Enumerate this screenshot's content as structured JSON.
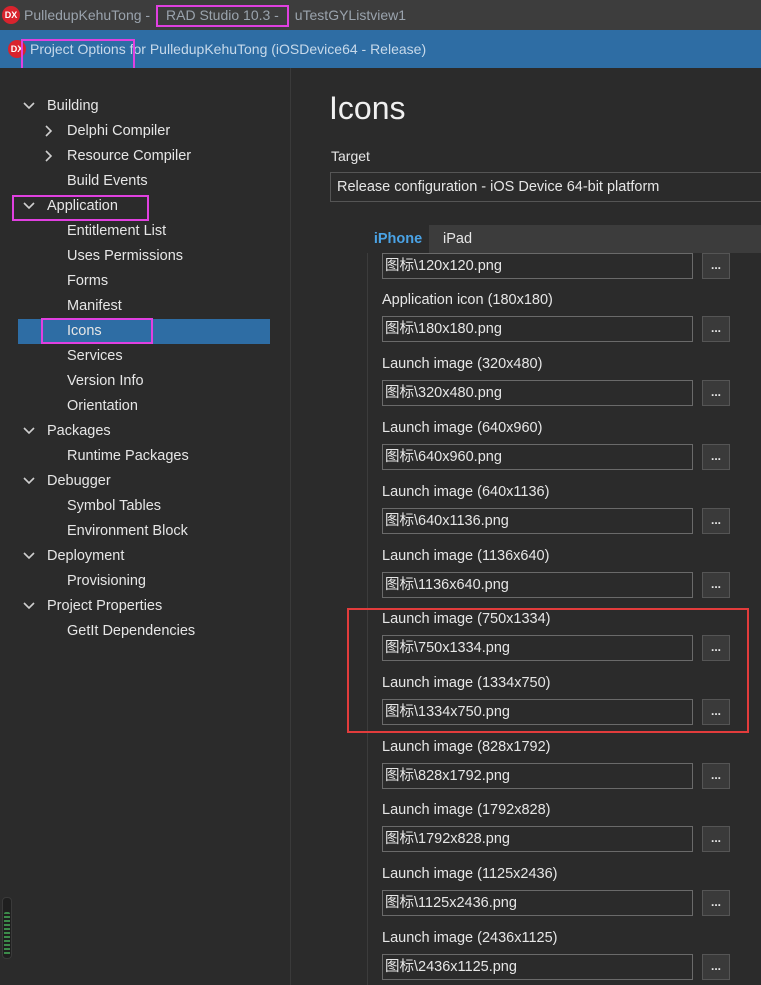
{
  "titlebar": {
    "part1": "PulledupKehuTong - ",
    "part2": "RAD Studio 10.3 -",
    "part3": " uTestGYListview1"
  },
  "dialog": {
    "title_part1": "Project Options",
    "title_part2": " for PulledupKehuTong  (iOSDevice64 - Release)"
  },
  "tree": [
    {
      "label": "Building"
    },
    {
      "label": "Delphi Compiler"
    },
    {
      "label": "Resource Compiler"
    },
    {
      "label": "Build Events"
    },
    {
      "label": "Application"
    },
    {
      "label": "Entitlement List"
    },
    {
      "label": "Uses Permissions"
    },
    {
      "label": "Forms"
    },
    {
      "label": "Manifest"
    },
    {
      "label": "Icons"
    },
    {
      "label": "Services"
    },
    {
      "label": "Version Info"
    },
    {
      "label": "Orientation"
    },
    {
      "label": "Packages"
    },
    {
      "label": "Runtime Packages"
    },
    {
      "label": "Debugger"
    },
    {
      "label": "Symbol Tables"
    },
    {
      "label": "Environment Block"
    },
    {
      "label": "Deployment"
    },
    {
      "label": "Provisioning"
    },
    {
      "label": "Project Properties"
    },
    {
      "label": "GetIt Dependencies"
    }
  ],
  "page": {
    "heading": "Icons",
    "target_label": "Target",
    "target_value": "Release configuration - iOS Device 64-bit platform"
  },
  "tabs": [
    {
      "label": "iPhone"
    },
    {
      "label": "iPad"
    }
  ],
  "fields": [
    {
      "label": "",
      "value": "图标\\120x120.png"
    },
    {
      "label": "Application icon (180x180)",
      "value": "图标\\180x180.png"
    },
    {
      "label": "Launch image (320x480)",
      "value": "图标\\320x480.png"
    },
    {
      "label": "Launch image (640x960)",
      "value": "图标\\640x960.png"
    },
    {
      "label": "Launch image (640x1136)",
      "value": "图标\\640x1136.png"
    },
    {
      "label": "Launch image (1136x640)",
      "value": "图标\\1136x640.png"
    },
    {
      "label": "Launch image (750x1334)",
      "value": "图标\\750x1334.png"
    },
    {
      "label": "Launch image (1334x750)",
      "value": "图标\\1334x750.png"
    },
    {
      "label": "Launch image (828x1792)",
      "value": "图标\\828x1792.png"
    },
    {
      "label": "Launch image (1792x828)",
      "value": "图标\\1792x828.png"
    },
    {
      "label": "Launch image (1125x2436)",
      "value": "图标\\1125x2436.png"
    },
    {
      "label": "Launch image (2436x1125)",
      "value": "图标\\2436x1125.png"
    }
  ],
  "browse_label": "...",
  "icons": {
    "logo": "dx-logo-icon",
    "expanded": "chevron-down-icon",
    "collapsed": "chevron-right-icon",
    "scroll_up": "chevron-up-icon",
    "scroll_down": "chevron-down-icon"
  },
  "logo_text": "DX",
  "colors": {
    "accent": "#2e6da4",
    "highlight": "#e040e0",
    "red_box": "#e23c3c",
    "tab_active": "#4aa3e6"
  }
}
